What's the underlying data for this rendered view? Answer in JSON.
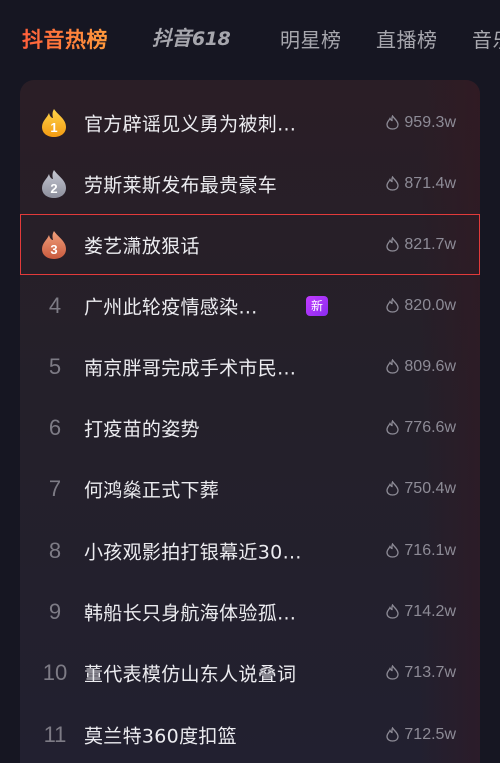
{
  "tabs": [
    {
      "label": "抖音热榜",
      "active": true
    },
    {
      "label": "抖音618",
      "logo": true
    },
    {
      "label": "明星榜"
    },
    {
      "label": "直播榜"
    },
    {
      "label": "音乐"
    }
  ],
  "logo_tab": {
    "text": "抖音",
    "num": "618"
  },
  "colors": {
    "accent": "#ff6a3b",
    "gold": "#f5b41a",
    "silver": "#a4a6b2",
    "bronze": "#d9745a",
    "new_badge": "#b23cff",
    "selected_outline": "#e23a3a"
  },
  "list": [
    {
      "rank": "1",
      "title": "官方辟谣见义勇为被刺…",
      "heat": "959.3w",
      "medal": "gold"
    },
    {
      "rank": "2",
      "title": "劳斯莱斯发布最贵豪车",
      "heat": "871.4w",
      "medal": "silver"
    },
    {
      "rank": "3",
      "title": "娄艺潇放狠话",
      "heat": "821.7w",
      "medal": "bronze",
      "selected": true
    },
    {
      "rank": "4",
      "title": "广州此轮疫情感染…",
      "heat": "820.0w",
      "badge": "新"
    },
    {
      "rank": "5",
      "title": "南京胖哥完成手术市民…",
      "heat": "809.6w"
    },
    {
      "rank": "6",
      "title": "打疫苗的姿势",
      "heat": "776.6w"
    },
    {
      "rank": "7",
      "title": "何鸿燊正式下葬",
      "heat": "750.4w"
    },
    {
      "rank": "8",
      "title": "小孩观影拍打银幕近30…",
      "heat": "716.1w"
    },
    {
      "rank": "9",
      "title": "韩船长只身航海体验孤…",
      "heat": "714.2w"
    },
    {
      "rank": "10",
      "title": "董代表模仿山东人说叠词",
      "heat": "713.7w"
    },
    {
      "rank": "11",
      "title": "莫兰特360度扣篮",
      "heat": "712.5w"
    }
  ]
}
